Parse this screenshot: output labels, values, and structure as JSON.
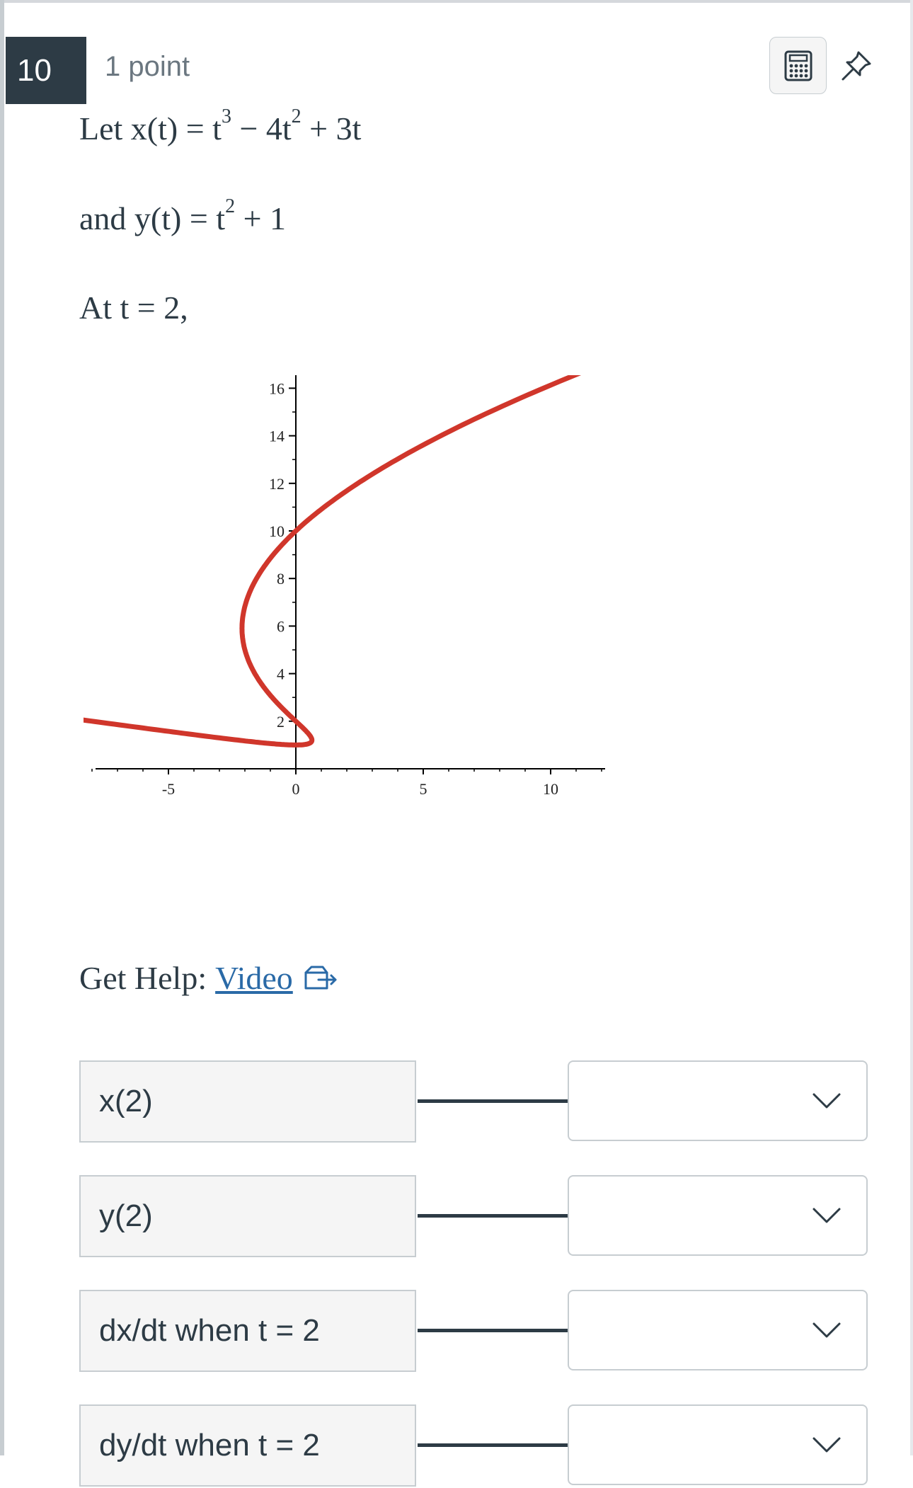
{
  "question": {
    "number": "10",
    "points": "1 point"
  },
  "icons": {
    "calculator": "calculator-icon",
    "pin": "pin-icon",
    "external": "external-link-icon",
    "chevron": "chevron-down-icon"
  },
  "colors": {
    "curve": "#d0362b",
    "link": "#2a6aa7",
    "header": "#2d3b45"
  },
  "problem": {
    "line1_prefix": "Let x(t) = t",
    "line1_exp1": "3",
    "line1_mid": " − 4t",
    "line1_exp2": "2",
    "line1_suffix": " + 3t",
    "line2_prefix": "and y(t) = t",
    "line2_exp": "2",
    "line2_suffix": " + 1",
    "line3": "At t = 2,"
  },
  "chart_data": {
    "type": "line",
    "description_equation": "x = t^3 - 4t^2 + 3t, y = t^2 + 1",
    "t_range": [
      -2.0,
      4.0
    ],
    "x_ticks": [
      -5,
      0,
      5,
      10
    ],
    "y_ticks": [
      2,
      4,
      6,
      8,
      10,
      12,
      14,
      16
    ],
    "xlim": [
      -8,
      12
    ],
    "ylim": [
      0,
      17
    ],
    "series": [
      {
        "color": "#d0362b"
      }
    ]
  },
  "help": {
    "label": "Get Help:",
    "link": "Video"
  },
  "matches": [
    {
      "prompt": "x(2)",
      "selected": ""
    },
    {
      "prompt": "y(2)",
      "selected": ""
    },
    {
      "prompt": "dx/dt when t = 2",
      "selected": ""
    },
    {
      "prompt": "dy/dt when t = 2",
      "selected": ""
    }
  ]
}
